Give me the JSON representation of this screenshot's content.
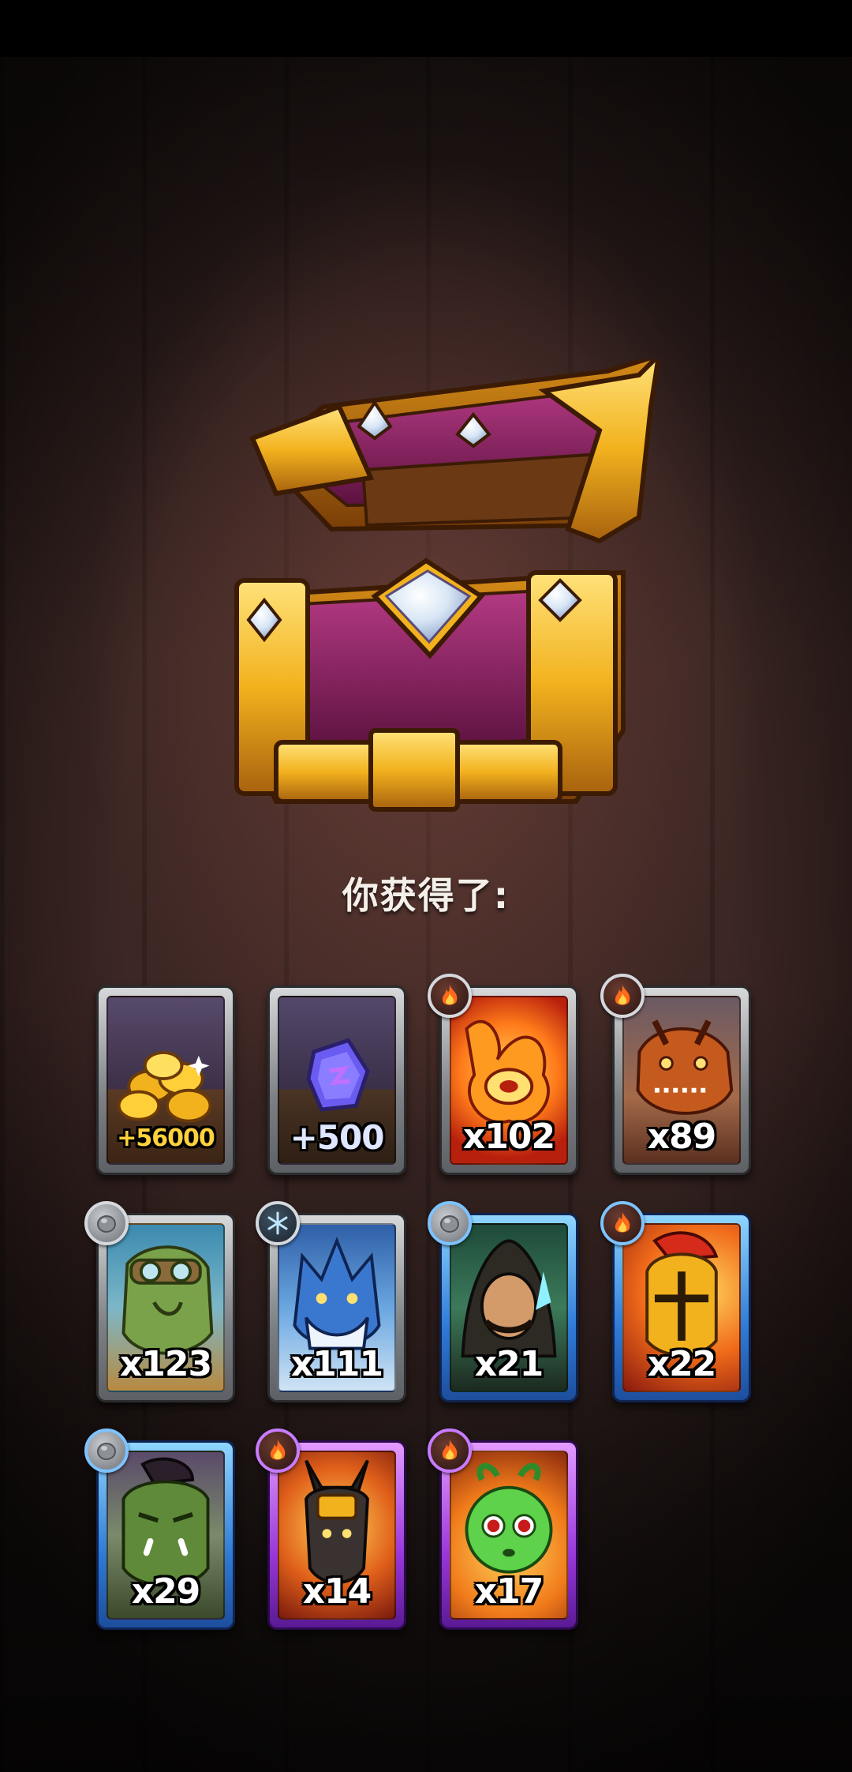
{
  "reward_screen": {
    "title": "你获得了:",
    "rewards": [
      {
        "kind": "gold",
        "quantity": "+56000",
        "icon": "gold-coins-icon",
        "frame": "grey",
        "element": null
      },
      {
        "kind": "gem",
        "quantity": "+500",
        "icon": "purple-gem-icon",
        "frame": "grey",
        "element": null
      },
      {
        "kind": "hero",
        "quantity": "x102",
        "icon": "fire-spirit-portrait",
        "frame": "grey",
        "element": "fire-icon"
      },
      {
        "kind": "hero",
        "quantity": "x89",
        "icon": "orange-dragon-portrait",
        "frame": "grey",
        "element": "fire-icon"
      },
      {
        "kind": "hero",
        "quantity": "x123",
        "icon": "goblin-pilot-portrait",
        "frame": "grey",
        "element": "stone-icon"
      },
      {
        "kind": "hero",
        "quantity": "x111",
        "icon": "ice-wolf-portrait",
        "frame": "grey",
        "element": "snowflake-icon"
      },
      {
        "kind": "hero",
        "quantity": "x21",
        "icon": "hooded-wizard-portrait",
        "frame": "blue",
        "element": "stone-icon"
      },
      {
        "kind": "hero",
        "quantity": "x22",
        "icon": "spartan-knight-portrait",
        "frame": "blue",
        "element": "fire-icon"
      },
      {
        "kind": "hero",
        "quantity": "x29",
        "icon": "orc-warrior-portrait",
        "frame": "blue",
        "element": "stone-icon"
      },
      {
        "kind": "hero",
        "quantity": "x14",
        "icon": "anubis-warrior-portrait",
        "frame": "purple",
        "element": "fire-icon"
      },
      {
        "kind": "hero",
        "quantity": "x17",
        "icon": "green-sprout-creature-portrait",
        "frame": "purple",
        "element": "fire-icon"
      }
    ]
  },
  "colors": {
    "background": "#3a2623",
    "title": "#f4efe9",
    "gold_text": "#ffd23c",
    "frame_grey": "#7c7f83",
    "frame_blue": "#2f7bd8",
    "frame_purple": "#9b37d9"
  }
}
